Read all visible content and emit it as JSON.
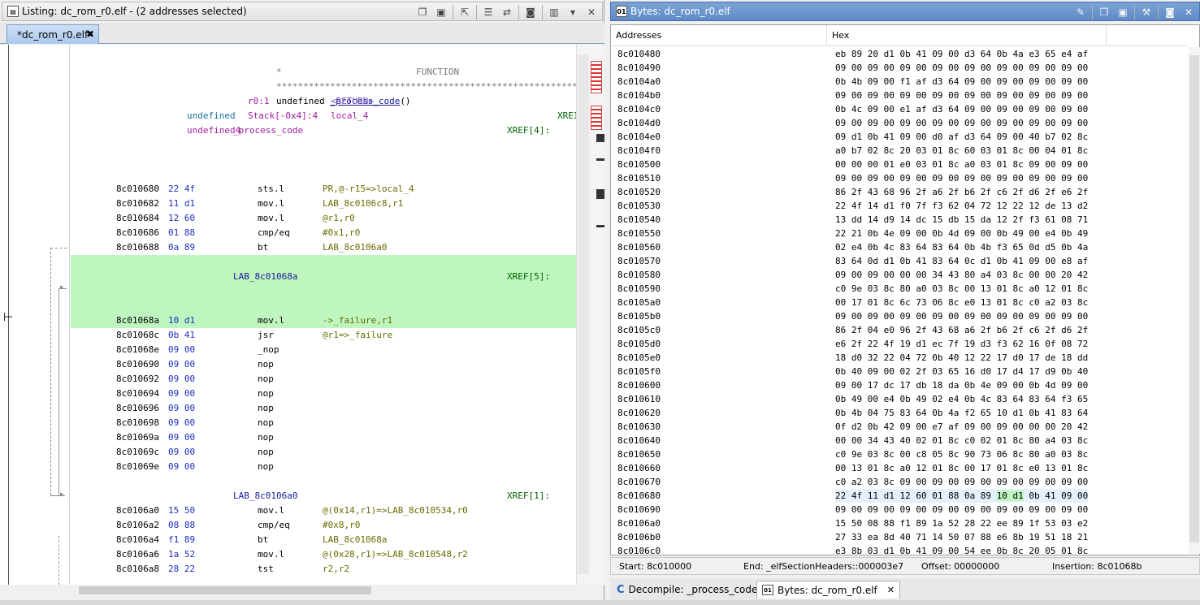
{
  "listing": {
    "title": "Listing:  dc_rom_r0.elf - (2 addresses selected)",
    "tab": "*dc_rom_r0.elf",
    "header_lines": [
      {
        "text": "*                         FUNCTION",
        "cls": "c-star"
      },
      {
        "text": "****************************************************************",
        "cls": "c-star"
      }
    ],
    "signature": {
      "ret": "undefined ",
      "name": "_process_code",
      "params": "()"
    },
    "vars": [
      {
        "type": "undefined",
        "loc": "r0:1",
        "name": "<RETURN>",
        "xref": ""
      },
      {
        "type": "undefined4",
        "loc": "Stack[-0x4]:4",
        "name": "local_4",
        "xref": "XREI"
      }
    ],
    "func_label": "_process_code",
    "func_xref": "XREF[4]:",
    "instr_block1": [
      {
        "addr": "8c010680",
        "bytes": "22 4f",
        "mn": "sts.l",
        "op": "PR,@-r15=>local_4"
      },
      {
        "addr": "8c010682",
        "bytes": "11 d1",
        "mn": "mov.l",
        "op": "LAB_8c0106c8,r1"
      },
      {
        "addr": "8c010684",
        "bytes": "12 60",
        "mn": "mov.l",
        "op": "@r1,r0"
      },
      {
        "addr": "8c010686",
        "bytes": "01 88",
        "mn": "cmp/eq",
        "op": "#0x1,r0"
      },
      {
        "addr": "8c010688",
        "bytes": "0a 89",
        "mn": "bt",
        "op": "LAB_8c0106a0"
      }
    ],
    "label2": "LAB_8c01068a",
    "label2_xref": "XREF[5]:",
    "instr_block2": [
      {
        "addr": "8c01068a",
        "bytes": "10 d1",
        "mn": "mov.l",
        "op": "->_failure,r1"
      },
      {
        "addr": "8c01068c",
        "bytes": "0b 41",
        "mn": "jsr",
        "op": "@r1=>_failure"
      },
      {
        "addr": "8c01068e",
        "bytes": "09 00",
        "mn": "_nop",
        "op": ""
      },
      {
        "addr": "8c010690",
        "bytes": "09 00",
        "mn": "nop",
        "op": ""
      },
      {
        "addr": "8c010692",
        "bytes": "09 00",
        "mn": "nop",
        "op": ""
      },
      {
        "addr": "8c010694",
        "bytes": "09 00",
        "mn": "nop",
        "op": ""
      },
      {
        "addr": "8c010696",
        "bytes": "09 00",
        "mn": "nop",
        "op": ""
      },
      {
        "addr": "8c010698",
        "bytes": "09 00",
        "mn": "nop",
        "op": ""
      },
      {
        "addr": "8c01069a",
        "bytes": "09 00",
        "mn": "nop",
        "op": ""
      },
      {
        "addr": "8c01069c",
        "bytes": "09 00",
        "mn": "nop",
        "op": ""
      },
      {
        "addr": "8c01069e",
        "bytes": "09 00",
        "mn": "nop",
        "op": ""
      }
    ],
    "label3": "LAB_8c0106a0",
    "label3_xref": "XREF[1]:",
    "instr_block3": [
      {
        "addr": "8c0106a0",
        "bytes": "15 50",
        "mn": "mov.l",
        "op": "@(0x14,r1)=>LAB_8c010534,r0"
      },
      {
        "addr": "8c0106a2",
        "bytes": "08 88",
        "mn": "cmp/eq",
        "op": "#0x8,r0"
      },
      {
        "addr": "8c0106a4",
        "bytes": "f1 89",
        "mn": "bt",
        "op": "LAB_8c01068a"
      },
      {
        "addr": "8c0106a6",
        "bytes": "1a 52",
        "mn": "mov.l",
        "op": "@(0x28,r1)=>LAB_8c010548,r2"
      },
      {
        "addr": "8c0106a8",
        "bytes": "28 22",
        "mn": "tst",
        "op": "r2,r2"
      }
    ]
  },
  "bytes_view": {
    "title": "Bytes: dc_rom_r0.elf",
    "col_addresses": "Addresses",
    "col_hex": "Hex",
    "rows": [
      [
        "8c010480",
        "eb 89 20 d1 0b 41 09 00 d3 64 0b 4a e3 65 e4 af"
      ],
      [
        "8c010490",
        "09 00 09 00 09 00 09 00 09 00 09 00 09 00 09 00"
      ],
      [
        "8c0104a0",
        "0b 4b 09 00 f1 af d3 64 09 00 09 00 09 00 09 00"
      ],
      [
        "8c0104b0",
        "09 00 09 00 09 00 09 00 09 00 09 00 09 00 09 00"
      ],
      [
        "8c0104c0",
        "0b 4c 09 00 e1 af d3 64 09 00 09 00 09 00 09 00"
      ],
      [
        "8c0104d0",
        "09 00 09 00 09 00 09 00 09 00 09 00 09 00 09 00"
      ],
      [
        "8c0104e0",
        "09 d1 0b 41 09 00 d0 af d3 64 09 00 40 b7 02 8c"
      ],
      [
        "8c0104f0",
        "a0 b7 02 8c 20 03 01 8c 60 03 01 8c 00 04 01 8c"
      ],
      [
        "8c010500",
        "00 00 00 01 e0 03 01 8c a0 03 01 8c 09 00 09 00"
      ],
      [
        "8c010510",
        "09 00 09 00 09 00 09 00 09 00 09 00 09 00 09 00"
      ],
      [
        "8c010520",
        "86 2f 43 68 96 2f a6 2f b6 2f c6 2f d6 2f e6 2f"
      ],
      [
        "8c010530",
        "22 4f 14 d1 f0 7f f3 62 04 72 12 22 12 de 13 d2"
      ],
      [
        "8c010540",
        "13 dd 14 d9 14 dc 15 db 15 da 12 2f f3 61 08 71"
      ],
      [
        "8c010550",
        "22 21 0b 4e 09 00 0b 4d 09 00 0b 49 00 e4 0b 49"
      ],
      [
        "8c010560",
        "02 e4 0b 4c 83 64 83 64 0b 4b f3 65 0d d5 0b 4a"
      ],
      [
        "8c010570",
        "83 64 0d d1 0b 41 83 64 0c d1 0b 41 09 00 e8 af"
      ],
      [
        "8c010580",
        "09 00 09 00 00 00 34 43 80 a4 03 8c 00 00 20 42"
      ],
      [
        "8c010590",
        "c0 9e 03 8c 80 a0 03 8c 00 13 01 8c a0 12 01 8c"
      ],
      [
        "8c0105a0",
        "00 17 01 8c 6c 73 06 8c e0 13 01 8c c0 a2 03 8c"
      ],
      [
        "8c0105b0",
        "09 00 09 00 09 00 09 00 09 00 09 00 09 00 09 00"
      ],
      [
        "8c0105c0",
        "86 2f 04 e0 96 2f 43 68 a6 2f b6 2f c6 2f d6 2f"
      ],
      [
        "8c0105d0",
        "e6 2f 22 4f 19 d1 ec 7f 19 d3 f3 62 16 0f 08 72"
      ],
      [
        "8c0105e0",
        "18 d0 32 22 04 72 0b 40 12 22 17 d0 17 de 18 dd"
      ],
      [
        "8c0105f0",
        "0b 40 09 00 02 2f 03 65 16 d0 17 d4 17 d9 0b 40"
      ],
      [
        "8c010600",
        "09 00 17 dc 17 db 18 da 0b 4e 09 00 0b 4d 09 00"
      ],
      [
        "8c010610",
        "0b 49 00 e4 0b 49 02 e4 0b 4c 83 64 83 64 f3 65"
      ],
      [
        "8c010620",
        "0b 4b 04 75 83 64 0b 4a f2 65 10 d1 0b 41 83 64"
      ],
      [
        "8c010630",
        "0f d2 0b 42 09 00 e7 af 09 00 09 00 00 00 20 42"
      ],
      [
        "8c010640",
        "00 00 34 43 40 02 01 8c c0 02 01 8c 80 a4 03 8c"
      ],
      [
        "8c010650",
        "c0 9e 03 8c 00 c8 05 8c 90 73 06 8c 80 a0 03 8c"
      ],
      [
        "8c010660",
        "00 13 01 8c a0 12 01 8c 00 17 01 8c e0 13 01 8c"
      ],
      [
        "8c010670",
        "c0 a2 03 8c 09 00 09 00 09 00 09 00 09 00 09 00"
      ],
      [
        "8c010680",
        "22 4f 11 d1 12 60 01 88 0a 89 10 d1 0b 41 09 00"
      ],
      [
        "8c010690",
        "09 00 09 00 09 00 09 00 09 00 09 00 09 00 09 00"
      ],
      [
        "8c0106a0",
        "15 50 08 88 f1 89 1a 52 28 22 ee 89 1f 53 03 e2"
      ],
      [
        "8c0106b0",
        "27 33 ea 8d 40 71 14 50 07 88 e6 8b 19 51 18 21"
      ],
      [
        "8c0106c0",
        "e3 8b 03 d1 0b 41 09 00 54 ee 0b 8c 20 05 01 8c"
      ]
    ],
    "highlight_row": "8c010680",
    "highlight_bytes": "10 d1",
    "status": {
      "start": "Start:  8c010000",
      "end": "End:  _elfSectionHeaders::000003e7",
      "offset": "Offset:  00000000",
      "insertion": "Insertion:  8c01068b"
    },
    "bottom_tabs": [
      {
        "label": "Decompile: _process_code",
        "icon": "decompile-icon"
      },
      {
        "label": "Bytes: dc_rom_r0.elf",
        "icon": "bytes-icon"
      }
    ]
  }
}
